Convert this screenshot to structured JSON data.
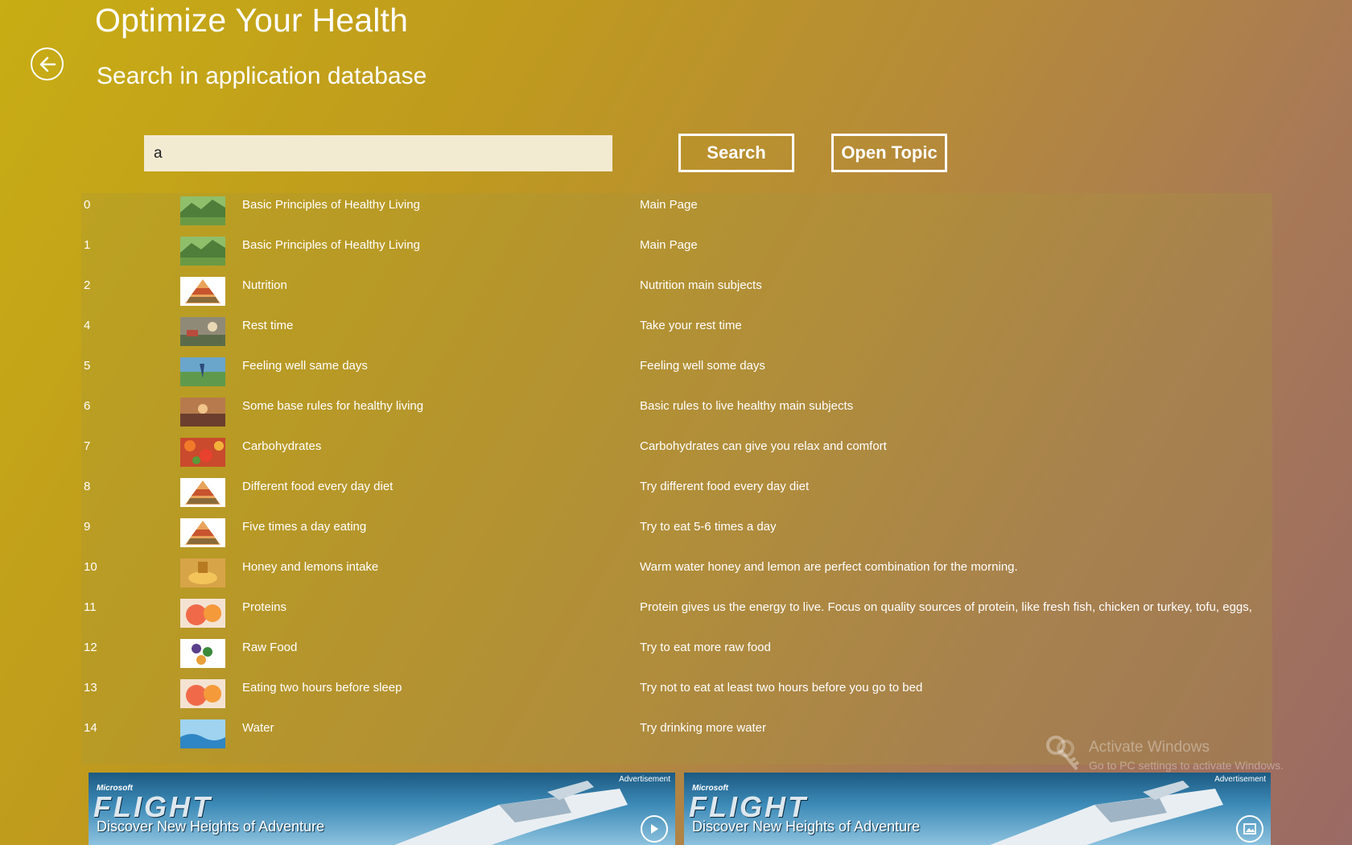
{
  "app": {
    "title": "Optimize Your Health",
    "subtitle": "Search in application database"
  },
  "search": {
    "value": "a",
    "button_label": "Search",
    "open_topic_label": "Open Topic"
  },
  "results": [
    {
      "id": "0",
      "title": "Basic Principles of Healthy Living",
      "description": "Main Page",
      "thumb": "landscape"
    },
    {
      "id": "1",
      "title": "Basic Principles of Healthy Living",
      "description": "Main Page",
      "thumb": "landscape"
    },
    {
      "id": "2",
      "title": "Nutrition",
      "description": "Nutrition main subjects",
      "thumb": "food-pyramid"
    },
    {
      "id": "4",
      "title": "Rest time",
      "description": "Take your rest time",
      "thumb": "rest"
    },
    {
      "id": "5",
      "title": "Feeling well same days",
      "description": "Feeling well some days",
      "thumb": "meadow"
    },
    {
      "id": "6",
      "title": "Some base rules for healthy living",
      "description": "Basic rules to live healthy main subjects",
      "thumb": "sunset"
    },
    {
      "id": "7",
      "title": "Carbohydrates",
      "description": "Carbohydrates can give you relax and comfort",
      "thumb": "vegetables"
    },
    {
      "id": "8",
      "title": "Different food every day diet",
      "description": "Try different food every day diet",
      "thumb": "food-pyramid"
    },
    {
      "id": "9",
      "title": "Five times a day eating",
      "description": "Try to eat 5-6 times a day",
      "thumb": "food-pyramid"
    },
    {
      "id": "10",
      "title": "Honey and lemons intake",
      "description": "Warm water honey and lemon are perfect combination for the morning.",
      "thumb": "honey"
    },
    {
      "id": "11",
      "title": "Proteins",
      "description": "Protein gives us the energy to live. Focus on quality sources of protein, like fresh fish, chicken or turkey, tofu, eggs, bea",
      "thumb": "grapefruit"
    },
    {
      "id": "12",
      "title": "Raw Food",
      "description": "Try to eat more raw food",
      "thumb": "raw-food"
    },
    {
      "id": "13",
      "title": "Eating two hours before sleep",
      "description": "Try not to eat at least two hours before you go to bed",
      "thumb": "grapefruit"
    },
    {
      "id": "14",
      "title": "Water",
      "description": "Try drinking more water",
      "thumb": "water"
    }
  ],
  "watermark": {
    "title": "Activate Windows",
    "subtitle": "Go to PC settings to activate Windows."
  },
  "ads": [
    {
      "brand": "Microsoft",
      "title": "FLIGHT",
      "tagline": "Discover New Heights of Adventure",
      "label": "Advertisement",
      "action_icon": "play-icon"
    },
    {
      "brand": "Microsoft",
      "title": "FLIGHT",
      "tagline": "Discover New Heights of Adventure",
      "label": "Advertisement",
      "action_icon": "gallery-icon"
    }
  ],
  "colors": {
    "background_start": "#c8ad14",
    "background_end": "#9a6a64",
    "input_bg": "#f3ead2"
  }
}
